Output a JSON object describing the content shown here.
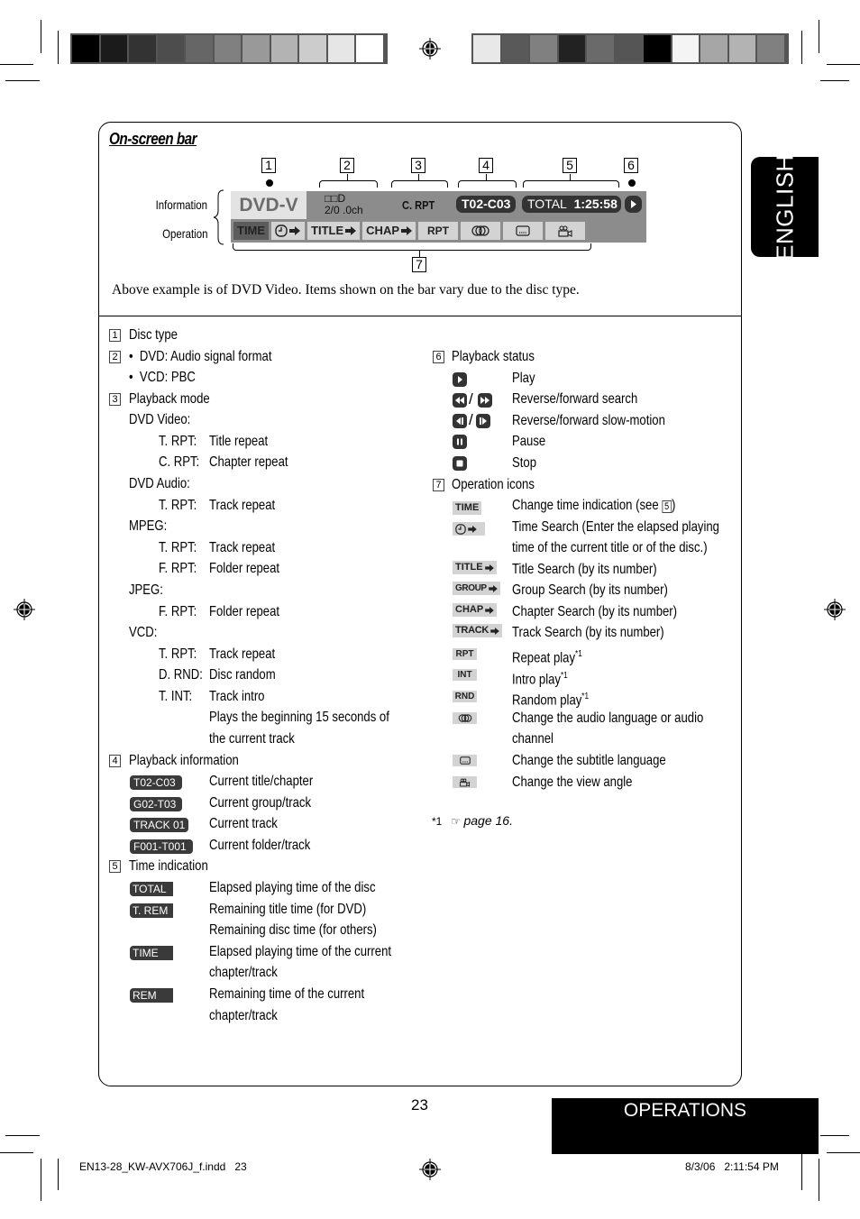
{
  "colors": {
    "osd_bar": "#8c8c8c",
    "osd_button": "#d3d3d3",
    "osd_active": "#5c5c5c",
    "badge": "#3a3a3a",
    "tab_black": "#000000"
  },
  "color_bar_left": [
    "#000000",
    "#1b1b1b",
    "#333333",
    "#4d4d4d",
    "#666666",
    "#808080",
    "#999999",
    "#b3b3b3",
    "#cccccc",
    "#e6e6e6",
    "#ffffff"
  ],
  "color_bar_right": [
    "#e8e8e8",
    "#595959",
    "#808080",
    "#222222",
    "#6a6a6a",
    "#555555",
    "#000000",
    "#f4f4f4",
    "#a6a6a6",
    "#b3b3b3",
    "#808080"
  ],
  "section": {
    "title": "On-screen bar",
    "info_label": "Information",
    "operation_label": "Operation",
    "callouts": [
      "1",
      "2",
      "3",
      "4",
      "5",
      "6",
      "7"
    ],
    "description": "Above example is of DVD Video. Items shown on the bar vary due to the disc type."
  },
  "osd": {
    "disc_type": "DVD-V",
    "audio_line1": "□□D",
    "audio_line2": "2/0 .0ch",
    "mode": "C. RPT",
    "chapter": "T02-C03",
    "time_label": "TOTAL",
    "time_value": "1:25:58",
    "status_icon": "play-icon",
    "ops": [
      {
        "label": "TIME",
        "icon": "",
        "active": true
      },
      {
        "label": "",
        "icon": "clock-arrow-icon"
      },
      {
        "label": "TITLE",
        "icon": "arrow-icon"
      },
      {
        "label": "CHAP",
        "icon": "arrow-icon"
      },
      {
        "label": "RPT",
        "icon": ""
      },
      {
        "label": "",
        "icon": "audio-icon"
      },
      {
        "label": "",
        "icon": "subtitle-icon"
      },
      {
        "label": "",
        "icon": "angle-camera-icon"
      }
    ]
  },
  "left": {
    "item1": {
      "num": "1",
      "title": "Disc type"
    },
    "item2": {
      "num": "2",
      "bullets": [
        "DVD: Audio signal format",
        "VCD: PBC"
      ]
    },
    "item3": {
      "num": "3",
      "title": "Playback mode",
      "groups": [
        {
          "name": "DVD Video:",
          "rows": [
            [
              "T. RPT:",
              "Title repeat"
            ],
            [
              "C. RPT:",
              "Chapter repeat"
            ]
          ]
        },
        {
          "name": "DVD Audio:",
          "rows": [
            [
              "T. RPT:",
              "Track repeat"
            ]
          ]
        },
        {
          "name": "MPEG:",
          "rows": [
            [
              "T. RPT:",
              "Track repeat"
            ],
            [
              "F. RPT:",
              "Folder repeat"
            ]
          ]
        },
        {
          "name": "JPEG:",
          "rows": [
            [
              "F. RPT:",
              "Folder repeat"
            ]
          ]
        },
        {
          "name": "VCD:",
          "rows": [
            [
              "T. RPT:",
              "Track repeat"
            ],
            [
              "D. RND:",
              "Disc random"
            ],
            [
              "T. INT:",
              "Track intro"
            ]
          ]
        }
      ],
      "intro_note": [
        "Plays the beginning 15 seconds of",
        "the current track"
      ]
    },
    "item4": {
      "num": "4",
      "title": "Playback information",
      "rows": [
        {
          "badge": "T02-C03",
          "text": "Current title/chapter"
        },
        {
          "badge": "G02-T03",
          "text": "Current group/track"
        },
        {
          "badge": "TRACK 01",
          "text": "Current track"
        },
        {
          "badge": "F001-T001",
          "text": "Current folder/track"
        }
      ]
    },
    "item5": {
      "num": "5",
      "title": "Time indication",
      "rows": [
        {
          "badge": "TOTAL",
          "lines": [
            "Elapsed playing time of the disc"
          ]
        },
        {
          "badge": "T. REM",
          "lines": [
            "Remaining title time (for DVD)",
            "Remaining disc time (for others)"
          ]
        },
        {
          "badge": "TIME",
          "lines": [
            "Elapsed playing time of the current",
            "chapter/track"
          ]
        },
        {
          "badge": "REM",
          "lines": [
            "Remaining time of the current",
            "chapter/track"
          ]
        }
      ]
    }
  },
  "right": {
    "item6": {
      "num": "6",
      "title": "Playback status",
      "rows": [
        {
          "icon": "play-icon",
          "text": "Play"
        },
        {
          "icon": "reverse-forward-search-icon",
          "text": "Reverse/forward search"
        },
        {
          "icon": "reverse-forward-slow-icon",
          "text": "Reverse/forward slow-motion"
        },
        {
          "icon": "pause-icon",
          "text": "Pause"
        },
        {
          "icon": "stop-icon",
          "text": "Stop"
        }
      ]
    },
    "item7": {
      "num": "7",
      "title": "Operation icons",
      "rows": [
        {
          "icon": "TIME",
          "lines": [
            "Change time indication (see",
            ")"
          ],
          "ref": "5"
        },
        {
          "icon": "",
          "lines": [
            "Time Search (Enter the elapsed playing",
            "time of the current title or of the disc.)"
          ]
        },
        {
          "icon": "TITLE",
          "lines": [
            "Title Search (by its number)"
          ]
        },
        {
          "icon": "GROUP",
          "lines": [
            "Group Search (by its number)"
          ]
        },
        {
          "icon": "CHAP",
          "lines": [
            "Chapter Search (by its number)"
          ]
        },
        {
          "icon": "TRACK",
          "lines": [
            "Track Search (by its number)"
          ]
        },
        {
          "icon": "RPT",
          "lines": [
            "Repeat play"
          ],
          "note": "*1"
        },
        {
          "icon": "INT",
          "lines": [
            "Intro play"
          ],
          "note": "*1"
        },
        {
          "icon": "RND",
          "lines": [
            "Random play"
          ],
          "note": "*1"
        },
        {
          "icon": "",
          "lines": [
            "Change the audio language or audio",
            "channel"
          ]
        },
        {
          "icon": "",
          "lines": [
            "Change the subtitle language"
          ]
        },
        {
          "icon": "",
          "lines": [
            "Change the view angle"
          ]
        }
      ]
    },
    "footnote": {
      "mark": "*1",
      "ref_icon": "☞",
      "text": "page 16."
    }
  },
  "tabs": {
    "language": "ENGLISH",
    "chapter": "OPERATIONS"
  },
  "page_number": "23",
  "footer": {
    "file": "EN13-28_KW-AVX706J_f.indd   23",
    "timestamp": "8/3/06   2:11:54 PM"
  }
}
